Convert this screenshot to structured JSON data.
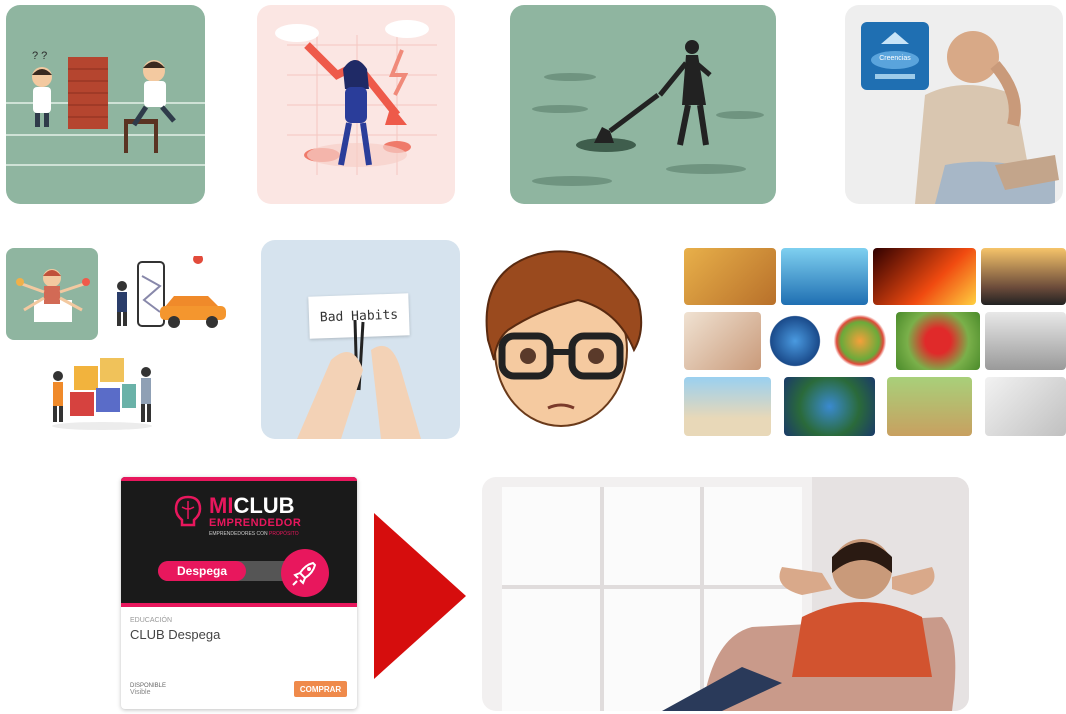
{
  "colors": {
    "tile_green": "#8fb5a0",
    "tile_pink": "#fbe6e3",
    "tile_grey": "#eeeeee",
    "tile_blue": "#d6e3ee",
    "card_dark": "#1a1a1a",
    "brand_pink": "#e8175d",
    "arrow_red": "#d60d0d",
    "buy_orange": "#ef8a4b"
  },
  "icons": {
    "wall": "brick-wall-icon",
    "rocket": "rocket-icon",
    "lightbulb": "lightbulb-brain-icon",
    "arrow": "play-arrow-icon"
  },
  "habits_card": {
    "text": "Bad Habits"
  },
  "pyramid_card": {
    "label": "Creencias"
  },
  "product_card": {
    "brand_mi": "MI",
    "brand_club": "CLUB",
    "brand_sub": "EMPRENDEDOR",
    "tagline": "EMPRENDEDORES CON ",
    "tagline_accent": "PROPÓSITO",
    "button_label": "Despega",
    "category": "EDUCACIÓN",
    "title": "CLUB Despega",
    "availability_label": "DISPONIBLE",
    "availability_value": "Visible",
    "buy_label": "COMPRAR"
  }
}
